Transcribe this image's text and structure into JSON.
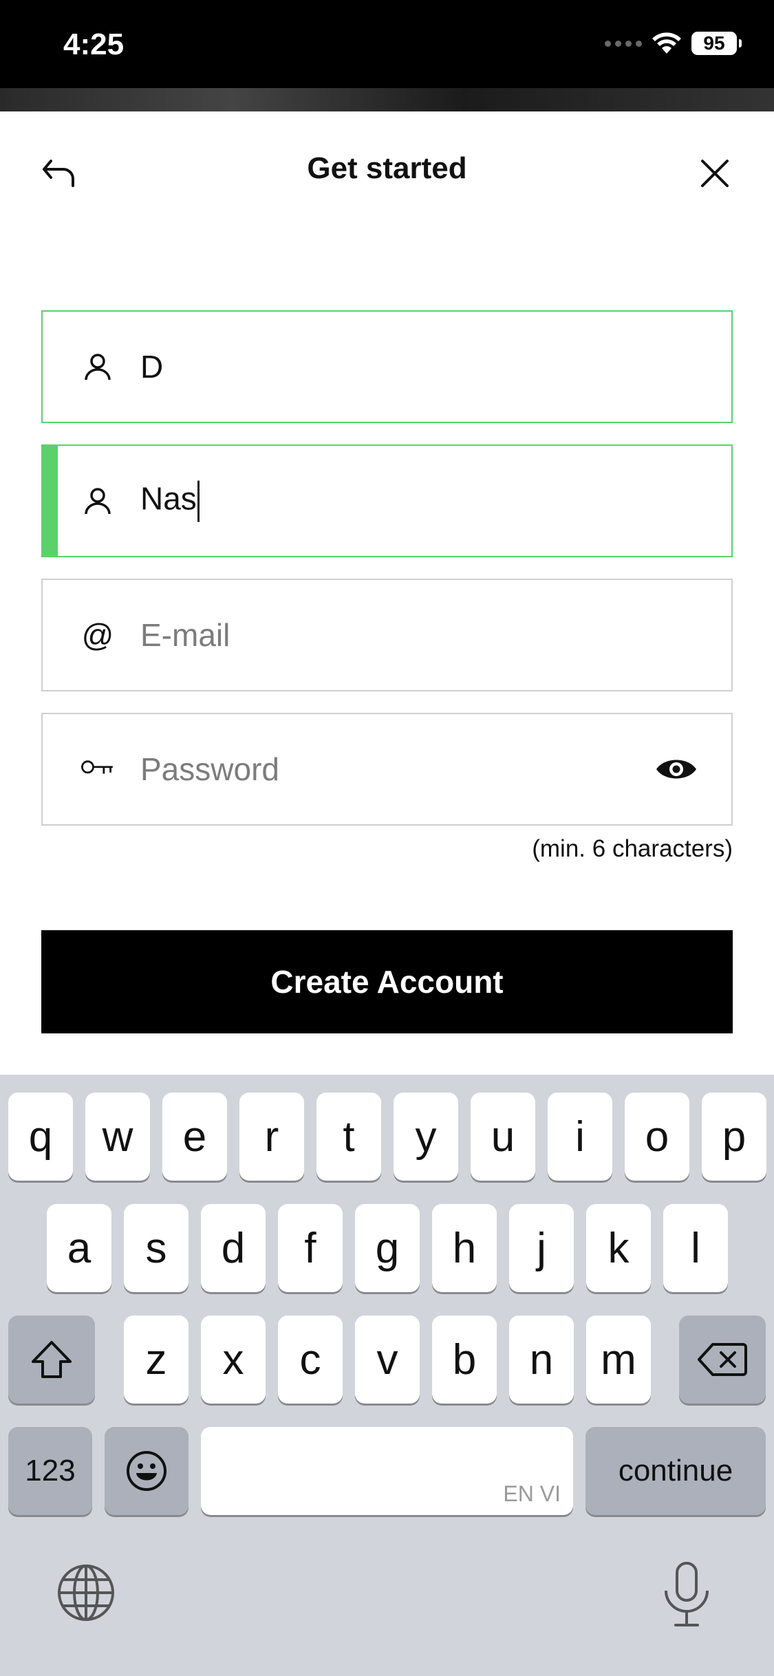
{
  "status_bar": {
    "time": "4:25",
    "battery": "95"
  },
  "header": {
    "title": "Get started"
  },
  "form": {
    "first_name": {
      "value": "D",
      "icon": "person-icon"
    },
    "last_name": {
      "value": "Nas",
      "icon": "person-icon"
    },
    "email": {
      "placeholder": "E-mail",
      "icon": "at-icon"
    },
    "password": {
      "placeholder": "Password",
      "icon": "key-icon",
      "toggle_icon": "eye-icon"
    },
    "password_hint": "(min. 6 characters)",
    "submit_label": "Create Account",
    "valid_color": "#5bd16a"
  },
  "keyboard": {
    "row1": [
      "q",
      "w",
      "e",
      "r",
      "t",
      "y",
      "u",
      "i",
      "o",
      "p"
    ],
    "row2": [
      "a",
      "s",
      "d",
      "f",
      "g",
      "h",
      "j",
      "k",
      "l"
    ],
    "row3": [
      "z",
      "x",
      "c",
      "v",
      "b",
      "n",
      "m"
    ],
    "numbers_label": "123",
    "return_label": "continue",
    "space_languages": "EN VI"
  }
}
